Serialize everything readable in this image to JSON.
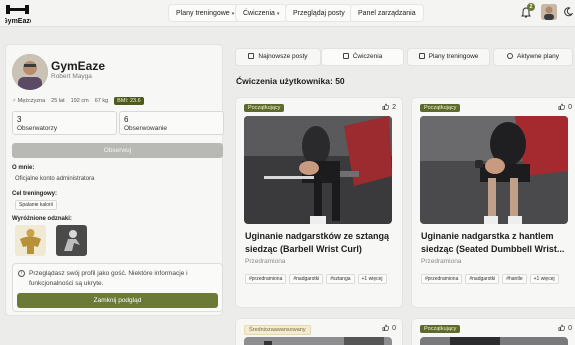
{
  "navbar": {
    "logo_text": "GymEaze",
    "items": [
      {
        "label": "Plany treningowe"
      },
      {
        "label": "Ćwiczenia"
      },
      {
        "label": "Przeglądaj posty"
      },
      {
        "label": "Panel zarządzania"
      }
    ],
    "notification_count": "2",
    "icons": {
      "bell": "bell-icon",
      "theme": "moon-icon",
      "dropdown": "chevron-down-icon"
    }
  },
  "profile": {
    "username": "GymEaze",
    "full_name": "Robert Mayga",
    "gender": "Mężczyzna",
    "age": "25 lat",
    "height": "192 cm",
    "weight": "67 kg",
    "bmi": "BMI: 23.6",
    "followers_count": "3",
    "followers_label": "Obserwatorzy",
    "following_count": "6",
    "following_label": "Obserwowanie",
    "follow_button": "Obserwuj",
    "about_title": "O mnie:",
    "about_text": "Oficjalne konto administratora",
    "goal_title": "Cel treningowy:",
    "goal_value": "Spalanie kalorii",
    "badges_title": "Wyróżnione odznaki:",
    "guest_notice": "Przeglądasz swój profil jako gość. Niektóre informacje i funkcjonalności są ukryte.",
    "close_preview_button": "Zamknij podgląd"
  },
  "tabs": [
    {
      "label": "Najnowsze posty",
      "icon": "message-icon"
    },
    {
      "label": "Ćwiczenia",
      "icon": "dumbbell-icon"
    },
    {
      "label": "Plany treningowe",
      "icon": "calendar-icon"
    },
    {
      "label": "Aktywne plany",
      "icon": "target-icon"
    }
  ],
  "section_heading": "Ćwiczenia użytkownika: 50",
  "exercises": [
    {
      "level": "Początkujący",
      "likes": "2",
      "title": "Uginanie nadgarstków ze sztangą siedząc (Barbell Wrist Curl)",
      "category": "Przedramiona",
      "tags": [
        "#przedramiona",
        "#nadgarstki",
        "#sztanga",
        "+1 więcej"
      ]
    },
    {
      "level": "Początkujący",
      "likes": "0",
      "title": "Uginanie nadgarstka z hantlem siedząc (Seated Dumbbell Wrist...",
      "category": "Przedramiona",
      "tags": [
        "#przedramiona",
        "#nadgarstki",
        "#hantle",
        "+1 więcej"
      ]
    },
    {
      "level": "Średniozaawansowany",
      "likes": "0"
    },
    {
      "level": "Początkujący",
      "likes": "0"
    }
  ]
}
